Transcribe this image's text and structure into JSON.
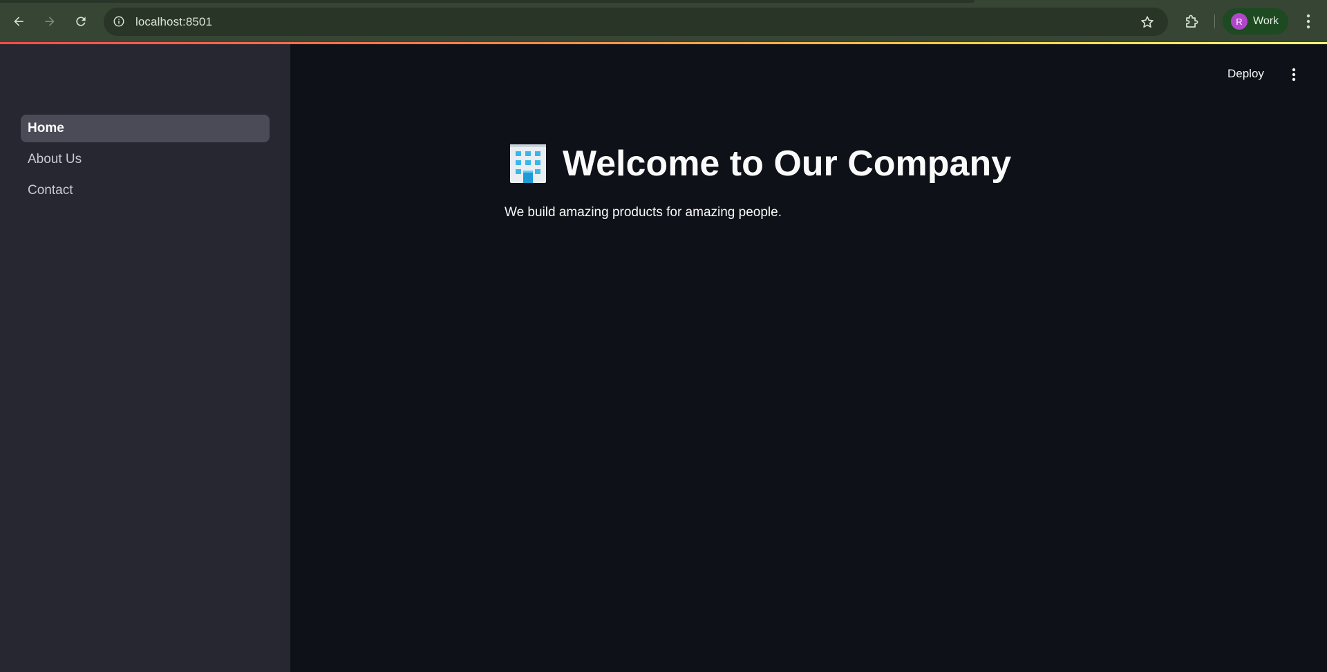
{
  "browser": {
    "url": "localhost:8501",
    "profile_initial": "R",
    "profile_label": "Work",
    "icons": [
      "back-arrow-icon",
      "forward-arrow-icon",
      "reload-icon",
      "info-icon",
      "star-icon",
      "extensions-icon",
      "more-vert-icon"
    ]
  },
  "sidebar": {
    "items": [
      {
        "label": "Home",
        "active": true
      },
      {
        "label": "About Us",
        "active": false
      },
      {
        "label": "Contact",
        "active": false
      }
    ]
  },
  "header": {
    "deploy_label": "Deploy"
  },
  "main": {
    "title_icon": "office-building-icon",
    "title": "Welcome to Our Company",
    "subtitle": "We build amazing products for amazing people."
  },
  "colors": {
    "app_background": "#0e1117",
    "sidebar_background": "#262730",
    "active_nav_background": "#4a4b56",
    "chrome_background": "#364534",
    "profile_avatar": "#b047c9"
  }
}
